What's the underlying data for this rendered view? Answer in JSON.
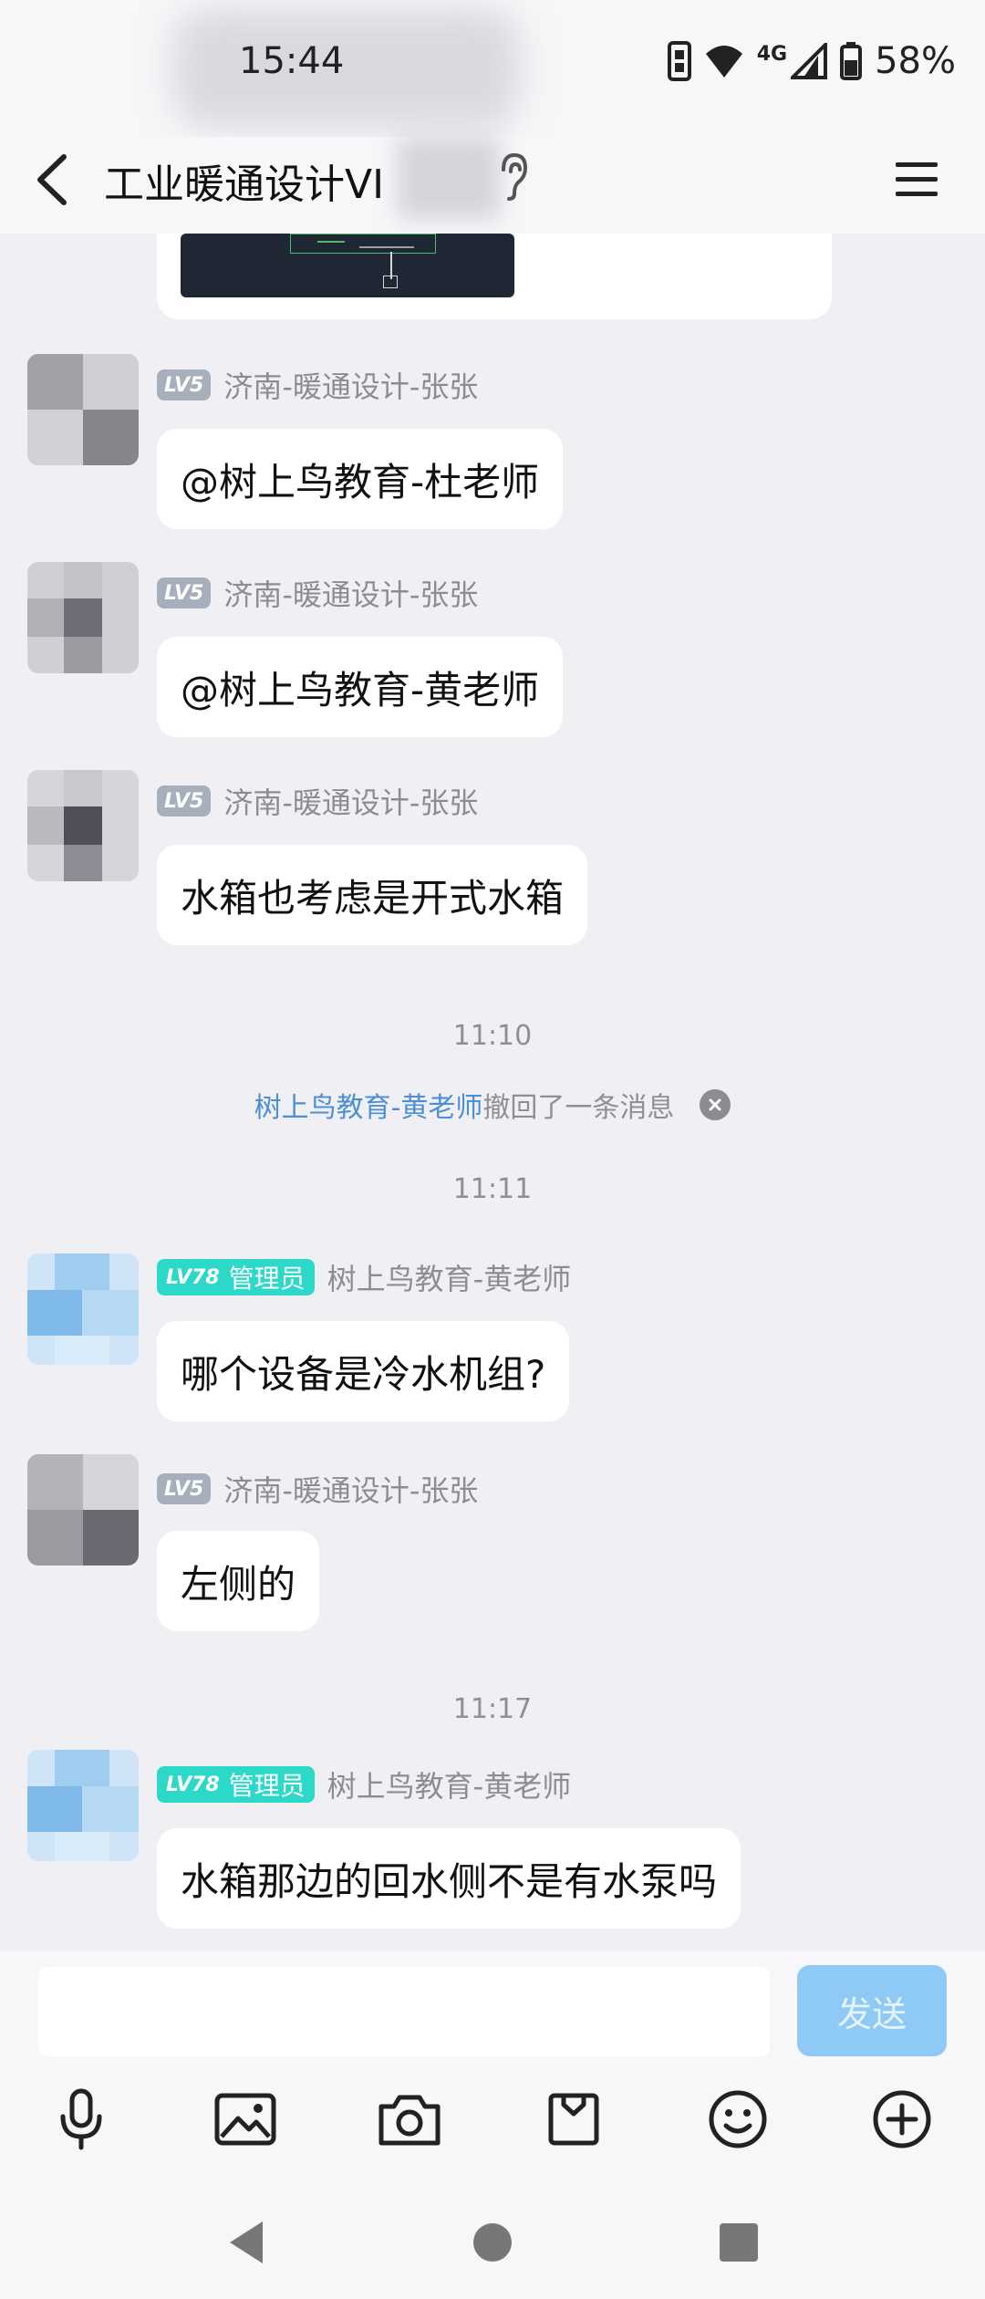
{
  "status_bar": {
    "time": "15:44",
    "network": "4G",
    "battery": "58%"
  },
  "header": {
    "title": "工业暖通设计VI"
  },
  "messages": [
    {
      "sender": "济南-暖通设计-张张",
      "level": "LV5",
      "text": "@树上鸟教育-杜老师"
    },
    {
      "sender": "济南-暖通设计-张张",
      "level": "LV5",
      "text": "@树上鸟教育-黄老师"
    },
    {
      "sender": "济南-暖通设计-张张",
      "level": "LV5",
      "text": "水箱也考虑是开式水箱"
    },
    {
      "sender": "树上鸟教育-黄老师",
      "level": "LV78",
      "role": "管理员",
      "text": "哪个设备是冷水机组?"
    },
    {
      "sender": "济南-暖通设计-张张",
      "level": "LV5",
      "text": "左侧的"
    },
    {
      "sender": "树上鸟教育-黄老师",
      "level": "LV78",
      "role": "管理员",
      "text": "水箱那边的回水侧不是有水泵吗"
    }
  ],
  "separators": {
    "time_1": "11:10",
    "time_2": "11:11",
    "time_3": "11:17"
  },
  "recall": {
    "name": "树上鸟教育-黄老师",
    "text": "撤回了一条消息"
  },
  "input": {
    "value": "",
    "send_label": "发送"
  },
  "colors": {
    "background": "#f0f0f4",
    "send_button": "#8fcaf6",
    "admin_badge": "#2cd8c8",
    "level_badge": "#a7afbd",
    "recall_link": "#4d8fd6"
  },
  "toolbar_icons": [
    "microphone-icon",
    "image-icon",
    "camera-icon",
    "mail-icon",
    "emoji-icon",
    "plus-icon"
  ]
}
